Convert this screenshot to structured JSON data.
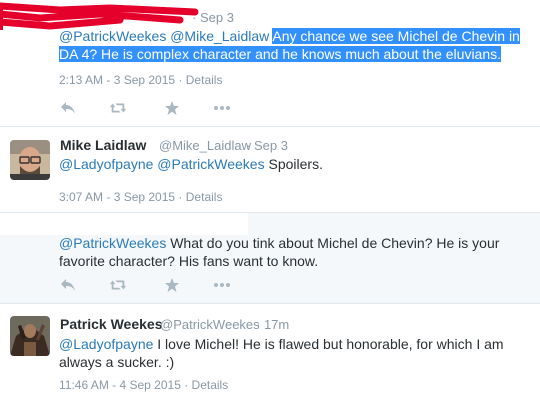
{
  "tweet1": {
    "date": "Sep 3",
    "mentions": "@PatrickWeekes @Mike_Laidlaw",
    "text": "Any chance we see Michel de Chevin in DA 4? He is complex character and he knows much about the eluvians.",
    "timestamp": "2:13 AM - 3 Sep 2015",
    "details": "Details"
  },
  "tweet2": {
    "name": "Mike Laidlaw",
    "handle": "@Mike_Laidlaw",
    "date": "Sep 3",
    "mentions": "@Ladyofpayne @PatrickWeekes",
    "text": "Spoilers.",
    "timestamp": "3:07 AM - 3 Sep 2015",
    "details": "Details"
  },
  "tweet3": {
    "mention": "@PatrickWeekes",
    "text": "What do you tink about Michel de Chevin? He is your favorite character? His fans want to know."
  },
  "tweet4": {
    "name": "Patrick Weekes",
    "handle": "@PatrickWeekes",
    "date": "17m",
    "mention": "@Ladyofpayne",
    "text": "I love Michel! He is flawed but honorable, for which I am always a sucker. :)",
    "timestamp": "11:46 AM - 4 Sep 2015",
    "details": "Details"
  },
  "colors": {
    "link": "#2b7bb9",
    "muted": "#8899a6",
    "highlight": "#3390ff",
    "redaction": "#e4002b"
  },
  "icons": [
    "reply-icon",
    "retweet-icon",
    "favorite-icon",
    "more-icon"
  ]
}
